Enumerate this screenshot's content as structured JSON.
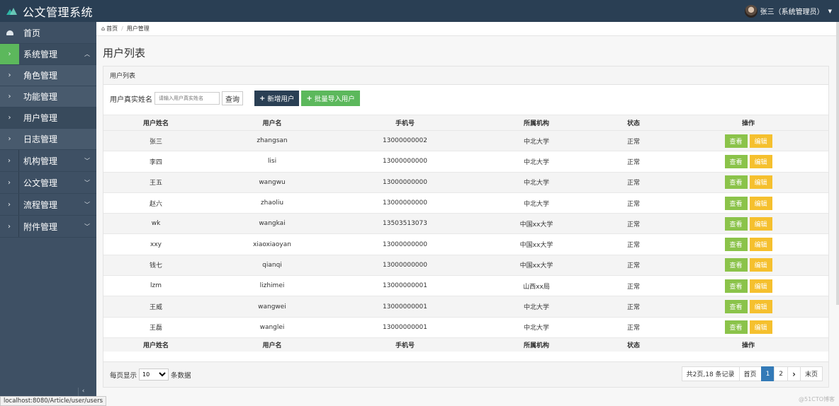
{
  "app": {
    "title": "公文管理系统",
    "user": "张三（系统管理员）"
  },
  "breadcrumb": {
    "home": "首页",
    "current": "用户管理"
  },
  "sidebar": {
    "home": "首页",
    "system": "系统管理",
    "sub_items": [
      "角色管理",
      "功能管理",
      "用户管理",
      "日志管理"
    ],
    "groups": [
      "机构管理",
      "公文管理",
      "流程管理",
      "附件管理"
    ]
  },
  "page": {
    "title": "用户列表",
    "panel_title": "用户列表"
  },
  "toolbar": {
    "search_label": "用户真实姓名",
    "search_placeholder": "请输入用户真实姓名",
    "query_label": "查询",
    "add_label": "新增用户",
    "import_label": "批量导入用户"
  },
  "table": {
    "headers": [
      "用户姓名",
      "用户名",
      "手机号",
      "所属机构",
      "状态",
      "操作"
    ],
    "rows": [
      [
        "张三",
        "zhangsan",
        "13000000002",
        "中北大学",
        "正常"
      ],
      [
        "李四",
        "lisi",
        "13000000000",
        "中北大学",
        "正常"
      ],
      [
        "王五",
        "wangwu",
        "13000000000",
        "中北大学",
        "正常"
      ],
      [
        "赵六",
        "zhaoliu",
        "13000000000",
        "中北大学",
        "正常"
      ],
      [
        "wk",
        "wangkai",
        "13503513073",
        "中国xx大学",
        "正常"
      ],
      [
        "xxy",
        "xiaoxiaoyan",
        "13000000000",
        "中国xx大学",
        "正常"
      ],
      [
        "钱七",
        "qianqi",
        "13000000000",
        "中国xx大学",
        "正常"
      ],
      [
        "lzm",
        "lizhimei",
        "13000000001",
        "山西xx局",
        "正常"
      ],
      [
        "王威",
        "wangwei",
        "13000000001",
        "中北大学",
        "正常"
      ],
      [
        "王磊",
        "wanglei",
        "13000000001",
        "中北大学",
        "正常"
      ]
    ],
    "view_label": "查看",
    "edit_label": "编辑"
  },
  "paging": {
    "prefix": "每页显示",
    "size": "10",
    "suffix": "条数据",
    "summary": "共2页,18 条记录",
    "first": "首页",
    "pages": [
      "1",
      "2"
    ],
    "next": "›",
    "last": "末页"
  },
  "status_url": "localhost:8080/Article/user/users",
  "watermark": "@51CTO博客",
  "colors": {
    "navbar": "#2a3f54",
    "sidebar": "#3e5064",
    "active": "#5cb85c",
    "view": "#8bc34a",
    "edit": "#f5c02e",
    "page_active": "#337ab7"
  },
  "icons": {
    "logo": "logo-icon",
    "home": "dashboard-icon",
    "caret": "caret-down-icon",
    "plus": "plus-icon"
  }
}
